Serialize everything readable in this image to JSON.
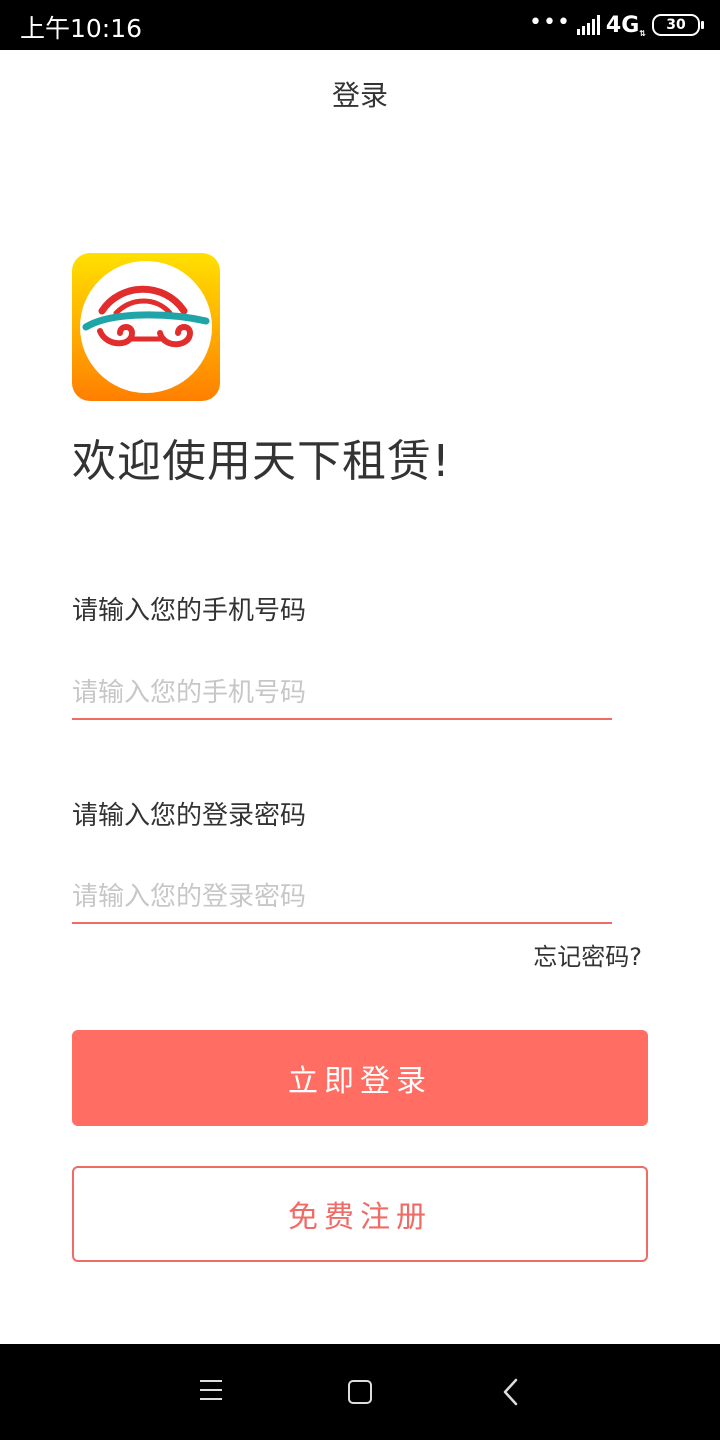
{
  "status_bar": {
    "time": "上午10:16",
    "dots": "•••",
    "network": "4G",
    "network_sub": "⇅",
    "battery": "30"
  },
  "header": {
    "title": "登录"
  },
  "logo": {
    "icon": "car-logo-icon"
  },
  "welcome": "欢迎使用天下租赁!",
  "form": {
    "phone_label": "请输入您的手机号码",
    "phone_placeholder": "请输入您的手机号码",
    "phone_value": "",
    "password_label": "请输入您的登录密码",
    "password_placeholder": "请输入您的登录密码",
    "password_value": "",
    "forgot": "忘记密码?"
  },
  "buttons": {
    "login": "立即登录",
    "register": "免费注册"
  },
  "colors": {
    "accent": "#ff6d63",
    "border": "#ee6b66",
    "logo_top": "#ffe000",
    "logo_bottom": "#ff7f00"
  },
  "nav": {
    "menu_icon": "menu-icon",
    "home_icon": "home-icon",
    "back_icon": "back-icon"
  }
}
